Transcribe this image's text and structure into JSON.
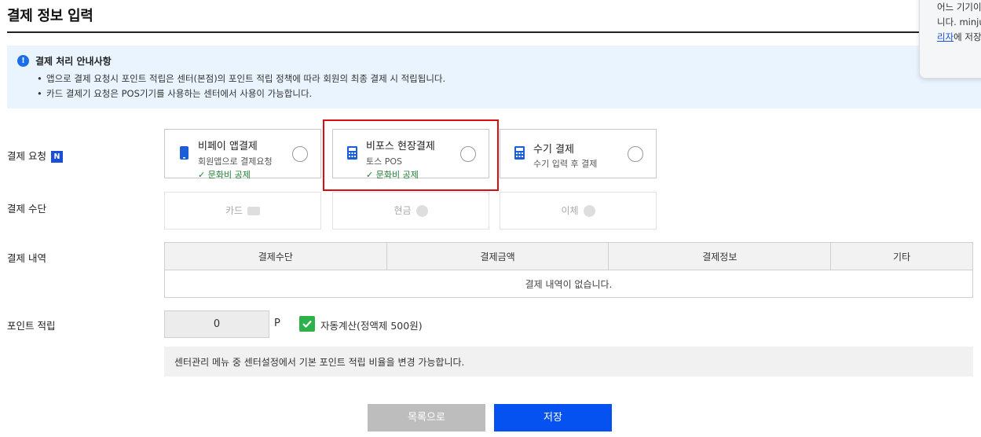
{
  "page": {
    "title": "결제 정보 입력"
  },
  "notice": {
    "icon": "info-icon",
    "title": "결제 처리 안내사항",
    "lines": [
      "앱으로 결제 요청시 포인트 적립은 센터(본점)의 포인트 적립 정책에 따라 회원의 최종 결제 시 적립됩니다.",
      "카드 결제기 요청은 POS기기를 사용하는 센터에서 사용이 가능합니다."
    ]
  },
  "popup": {
    "lines": [
      "어느 기기이",
      "니다. minju"
    ],
    "link_text": "리자",
    "link_suffix": "에 저장"
  },
  "request": {
    "label": "결제 요청",
    "badge": "N",
    "options": [
      {
        "title": "비페이 앱결제",
        "sub": "회원앱으로 결제요청",
        "check": "✓ 문화비 공제",
        "icon": "phone-icon",
        "selected": false
      },
      {
        "title": "비포스 현장결제",
        "sub": "토스 POS",
        "check": "✓ 문화비 공제",
        "icon": "calculator-icon",
        "selected": false
      },
      {
        "title": "수기 결제",
        "sub": "수기 입력 후 결제",
        "icon": "calculator-icon",
        "selected": false
      }
    ]
  },
  "method": {
    "label": "결제 수단",
    "options": [
      {
        "label": "카드",
        "icon": "card-icon"
      },
      {
        "label": "현금",
        "icon": "won-icon"
      },
      {
        "label": "이체",
        "icon": "transfer-icon"
      }
    ]
  },
  "history": {
    "label": "결제 내역",
    "columns": [
      "결제수단",
      "결제금액",
      "결제정보",
      "기타"
    ],
    "empty": "결제 내역이 없습니다."
  },
  "points": {
    "label": "포인트 적립",
    "value": "0",
    "unit": "P",
    "auto_label": "자동계산(정액제 500원)",
    "auto_checked": true,
    "info": "센터관리 메뉴 중 센터설정에서 기본 포인트 적립 비율을 변경 가능합니다."
  },
  "buttons": {
    "list": "목록으로",
    "save": "저장"
  },
  "colors": {
    "accent": "#0652f0",
    "highlight": "#d60f0f",
    "check": "#2db14a",
    "notice_bg": "#e9f4fe"
  }
}
